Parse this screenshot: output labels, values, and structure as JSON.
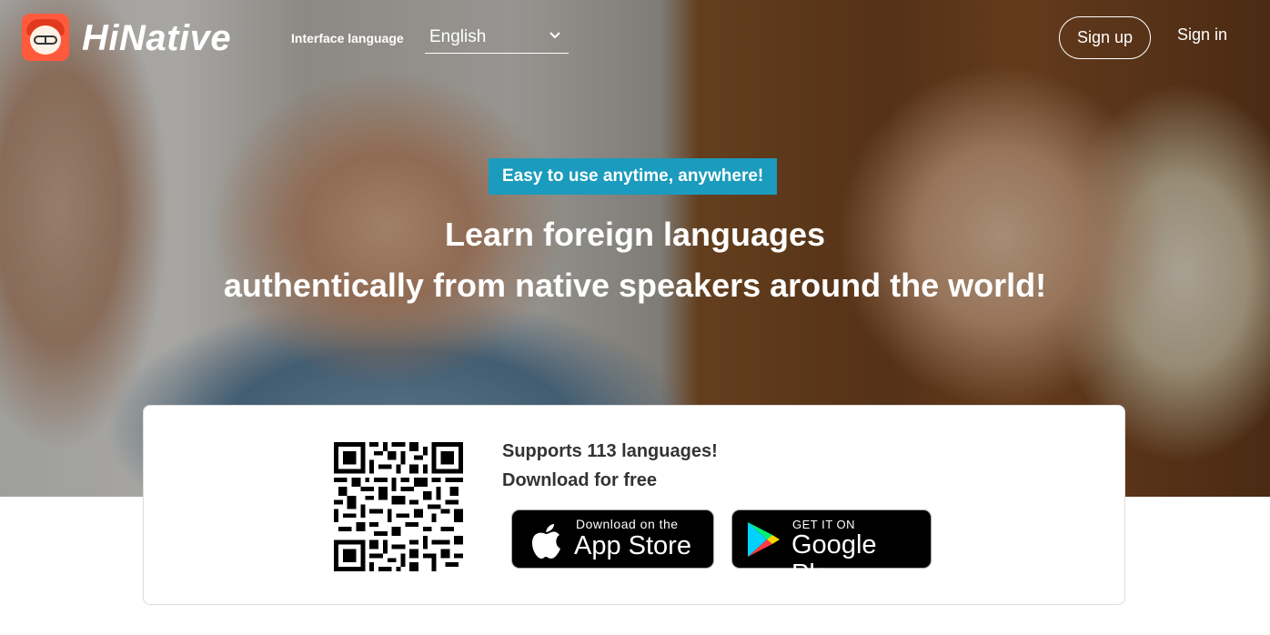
{
  "header": {
    "brand": "HiNative",
    "interface_language_label": "Interface language",
    "language_value": "English",
    "signup_label": "Sign up",
    "signin_label": "Sign in"
  },
  "hero": {
    "tagline": "Easy to use anytime, anywhere!",
    "headline_line1": "Learn foreign languages",
    "headline_line2": "authentically from native speakers around the world!"
  },
  "download": {
    "supports_text": "Supports 113 languages!",
    "download_text": "Download for free",
    "app_store": {
      "small": "Download on the",
      "big": "App Store"
    },
    "google_play": {
      "small": "GET IT ON",
      "big": "Google Play"
    }
  },
  "colors": {
    "tagline_bg": "#1b9bbd",
    "logo_bg": "#ff5a3c",
    "badge_bg": "#000000"
  },
  "icons": [
    "hinative-logo-icon",
    "chevron-down-icon",
    "qr-code-icon",
    "apple-icon",
    "google-play-icon"
  ]
}
